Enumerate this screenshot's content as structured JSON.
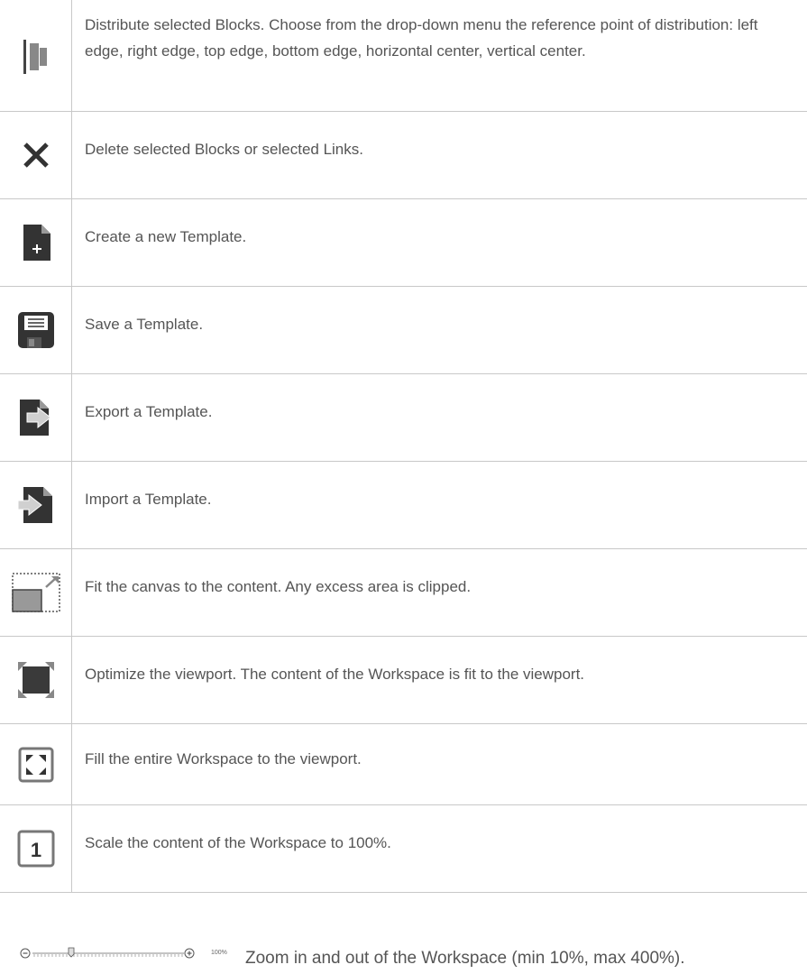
{
  "rows": [
    {
      "icon": "distribute-icon",
      "text": "Distribute selected Blocks. Choose from the drop-down menu the reference point of distribution: left edge, right edge, top edge, bottom edge, horizontal center, vertical center."
    },
    {
      "icon": "close-icon",
      "text": "Delete selected Blocks or selected Links."
    },
    {
      "icon": "new-document-icon",
      "text": "Create a new Template."
    },
    {
      "icon": "save-icon",
      "text": "Save a Template."
    },
    {
      "icon": "export-icon",
      "text": "Export a Template."
    },
    {
      "icon": "import-icon",
      "text": "Import a Template."
    },
    {
      "icon": "fit-canvas-icon",
      "text": "Fit the canvas to the content. Any excess area is clipped."
    },
    {
      "icon": "optimize-viewport-icon",
      "text": "Optimize the viewport. The content of the Workspace is fit to the viewport."
    },
    {
      "icon": "fill-workspace-icon",
      "text": "Fill the entire Workspace to the viewport."
    },
    {
      "icon": "scale-100-icon",
      "text": "Scale the content of the Workspace to 100%.",
      "glyph": "1"
    }
  ],
  "zoom": {
    "label": "100%",
    "text": "Zoom in and out of the Workspace (min 10%, max 400%).",
    "level_percent": 100
  }
}
